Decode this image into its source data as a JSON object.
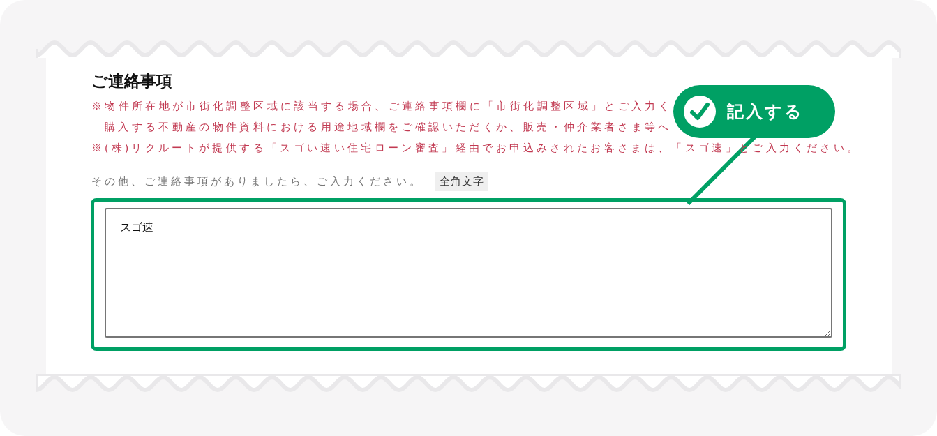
{
  "section": {
    "title": "ご連絡事項",
    "notes": [
      {
        "kind": "note",
        "text": "※物件所在地が市街化調整区域に該当する場合、ご連絡事項欄に「市街化調整区域」とご入力く"
      },
      {
        "kind": "continuation",
        "text": "購入する不動産の物件資料における用途地域欄をご確認いただくか、販売・仲介業者さま等へ"
      },
      {
        "kind": "note",
        "text": "※(株)リクルートが提供する「スゴい速い住宅ローン審査」経由でお申込みされたお客さまは、「スゴ速」とご入力ください。"
      }
    ],
    "hint": "その他、ご連絡事項がありましたら、ご入力ください。",
    "badge": "全角文字",
    "field": {
      "value": "スゴ速"
    }
  },
  "callout": {
    "label": "記入する"
  }
}
